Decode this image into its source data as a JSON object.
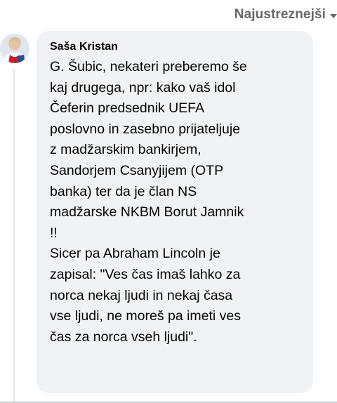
{
  "sort": {
    "label": "Najustreznejši"
  },
  "comment": {
    "author": "Saša Kristan",
    "text": "G. Šubic, nekateri preberemo še\nkaj drugega, npr: kako vaš idol\nČeferin predsednik UEFA\nposlovno in zasebno prijateljuje\nz madžarskim bankirjem,\nSandorjem Csanyjijem (OTP\nbanka) ter da je član NS\nmadžarske NKBM Borut Jamnik\n!!\nSicer pa Abraham Lincoln je\nzapisal: \"Ves čas imaš lahko za\nnorca nekaj ljudi in nekaj časa\nvse ljudi, ne moreš pa imeti ves\nčas za norca vseh ljudi\"."
  },
  "colors": {
    "bubble": "#f0f2f5",
    "text": "#050505",
    "secondary": "#65676b"
  }
}
